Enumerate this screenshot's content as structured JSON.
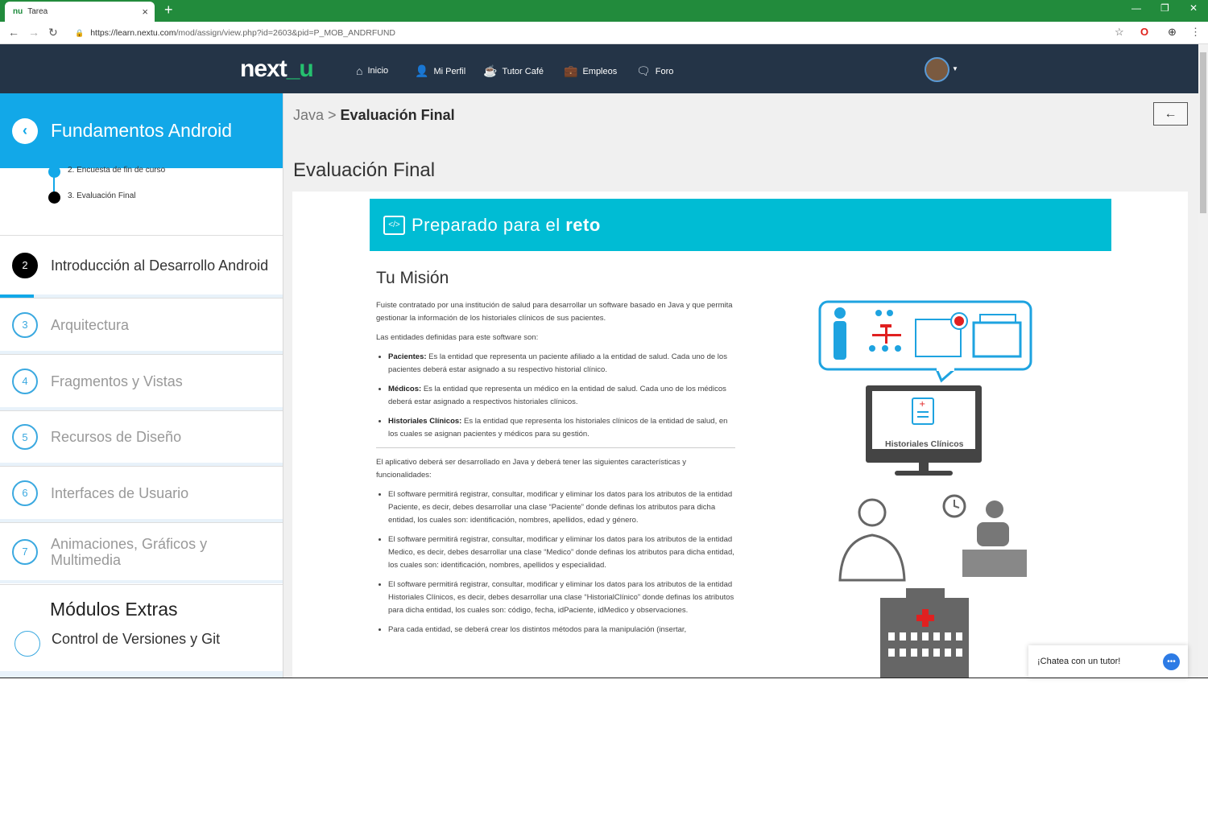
{
  "browser": {
    "tab_title": "Tarea",
    "tab_favicon": "nu",
    "url_host": "https://learn.nextu.com",
    "url_path": "/mod/assign/view.php?id=2603&pid=P_MOB_ANDRFUND"
  },
  "topnav": {
    "logo_main": "next",
    "logo_suffix": "_u",
    "items": [
      {
        "label": "Inicio",
        "icon": "home-icon"
      },
      {
        "label": "Mi Perfil",
        "icon": "user-icon"
      },
      {
        "label": "Tutor Café",
        "icon": "coffee-icon"
      },
      {
        "label": "Empleos",
        "icon": "briefcase-icon"
      },
      {
        "label": "Foro",
        "icon": "chat-icon"
      }
    ]
  },
  "sidebar": {
    "title": "Fundamentos Android",
    "subitems": [
      "2. Encuesta de fin de curso",
      "3. Evaluación Final"
    ],
    "modules": [
      {
        "num": "2",
        "label": "Introducción al Desarrollo Android"
      },
      {
        "num": "3",
        "label": "Arquitectura"
      },
      {
        "num": "4",
        "label": "Fragmentos y Vistas"
      },
      {
        "num": "5",
        "label": "Recursos de Diseño"
      },
      {
        "num": "6",
        "label": "Interfaces de Usuario"
      },
      {
        "num": "7",
        "label": "Animaciones, Gráficos y Multimedia"
      }
    ],
    "extras_title": "Módulos Extras",
    "extras_item": "Control de Versiones y Git"
  },
  "main": {
    "crumb_parent": "Java",
    "crumb_sep": " > ",
    "crumb_current": "Evaluación Final",
    "back_label": "←",
    "page_title": "Evaluación Final",
    "banner_text": "Preparado para el ",
    "banner_bold": "reto",
    "mission_title": "Tu Misión",
    "intro": "Fuiste contratado por una institución de salud para desarrollar un software basado en Java y que permita gestionar la información de los historiales clínicos de sus pacientes.",
    "entities_intro": "Las entidades definidas para este software son:",
    "entities": [
      {
        "name": "Pacientes:",
        "text": " Es la entidad que representa un paciente afiliado a la entidad de salud. Cada uno de los pacientes deberá estar asignado a su respectivo historial clínico."
      },
      {
        "name": "Médicos:",
        "text": " Es la entidad que representa un médico en la entidad de salud. Cada uno de los médicos deberá estar asignado a respectivos historiales clínicos."
      },
      {
        "name": "Historiales Clínicos:",
        "text": " Es la entidad que representa los historiales clínicos de la entidad de salud, en los cuales se asignan pacientes y médicos para su gestión."
      }
    ],
    "features_intro": "El aplicativo deberá ser desarrollado en Java y deberá tener las siguientes características y funcionalidades:",
    "features": [
      "El software permitirá registrar, consultar, modificar y eliminar los datos para los atributos de la entidad Paciente, es decir, debes desarrollar una clase “Paciente” donde definas los atributos para dicha entidad, los cuales son: identificación, nombres, apellidos, edad y género.",
      "El software permitirá registrar, consultar, modificar y eliminar los datos para los atributos de la entidad Medico, es decir, debes desarrollar una clase “Medico” donde definas los atributos para dicha entidad, los cuales son: identificación, nombres, apellidos y especialidad.",
      "El software permitirá registrar, consultar, modificar y eliminar los datos para los atributos de la entidad Historiales Clínicos, es decir, debes desarrollar una clase “HistorialClínico” donde definas los atributos para dicha entidad, los cuales son: código, fecha, idPaciente, idMedico y observaciones.",
      "Para cada entidad, se deberá crear los distintos métodos para la manipulación (insertar,"
    ],
    "illustration_label": "Historiales Clínicos"
  },
  "chat": {
    "label": "¡Chatea con un tutor!"
  },
  "colors": {
    "tabbar": "#228b3c",
    "topnav": "#243447",
    "sidebar_header": "#12a8e8",
    "banner": "#00bcd4",
    "logo_accent": "#25c16f"
  }
}
